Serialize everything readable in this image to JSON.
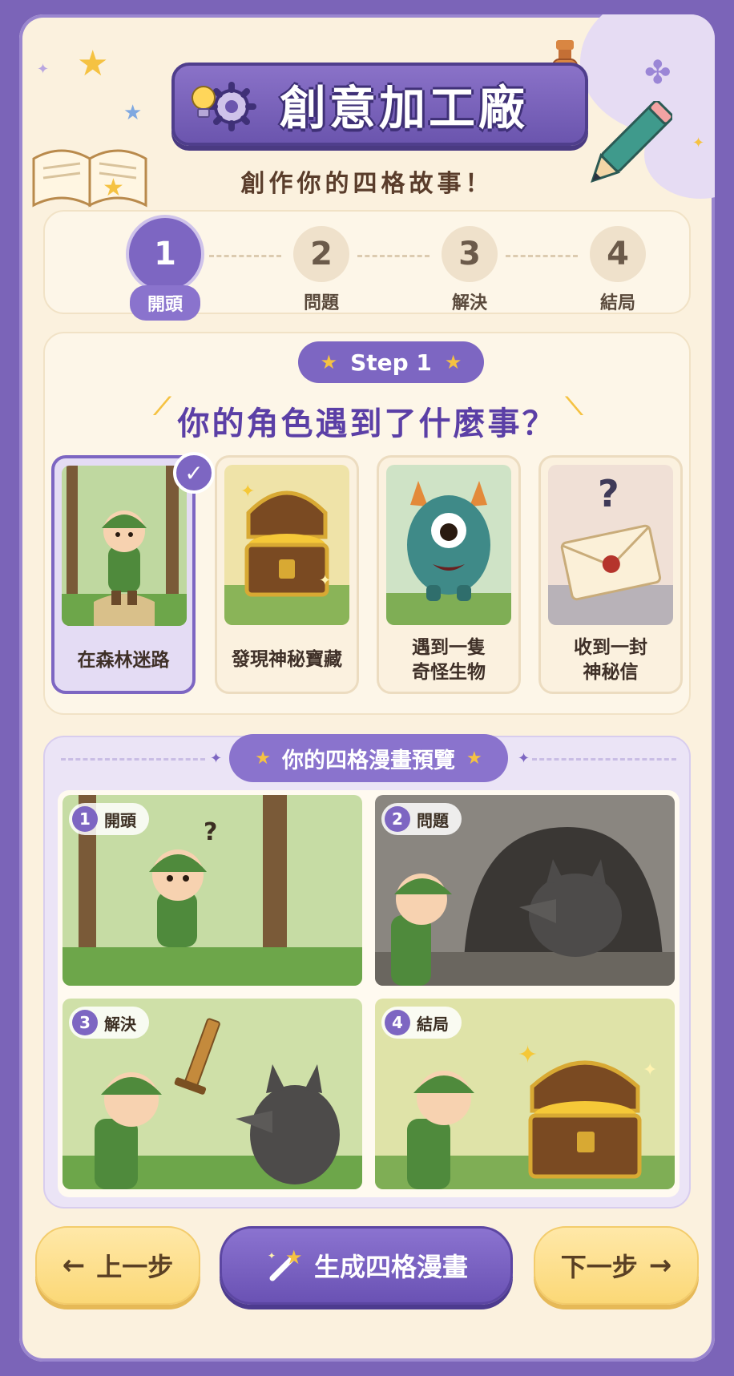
{
  "header": {
    "title": "創意加工廠",
    "subtitle": "創作你的四格故事！"
  },
  "stepper": {
    "steps": [
      {
        "number": "1",
        "label": "開頭",
        "active": true
      },
      {
        "number": "2",
        "label": "問題",
        "active": false
      },
      {
        "number": "3",
        "label": "解決",
        "active": false
      },
      {
        "number": "4",
        "label": "結局",
        "active": false
      }
    ]
  },
  "question_card": {
    "step_tag": "Step 1",
    "question": "你的角色遇到了什麼事？",
    "options": [
      {
        "label": "在森林迷路",
        "selected": true,
        "icon": "lost-boy-forest"
      },
      {
        "label": "發現神秘寶藏",
        "selected": false,
        "icon": "treasure-chest"
      },
      {
        "label": "遇到一隻\n奇怪生物",
        "selected": false,
        "icon": "green-monster"
      },
      {
        "label": "收到一封\n神秘信",
        "selected": false,
        "icon": "sealed-letter"
      }
    ]
  },
  "preview": {
    "title": "你的四格漫畫預覽",
    "panels": [
      {
        "number": "1",
        "label": "開頭"
      },
      {
        "number": "2",
        "label": "問題"
      },
      {
        "number": "3",
        "label": "解決"
      },
      {
        "number": "4",
        "label": "結局"
      }
    ]
  },
  "buttons": {
    "prev": "上一步",
    "generate": "生成四格漫畫",
    "next": "下一步"
  },
  "colors": {
    "primary": "#7d66c2",
    "background": "#fbf1de",
    "accent_yellow": "#fbd877"
  }
}
